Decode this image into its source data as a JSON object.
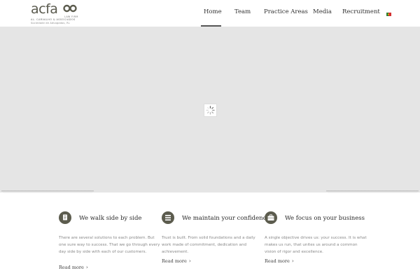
{
  "header": {
    "logo": {
      "brand": "acfa",
      "tagline": "LAW FIRM",
      "subtitle_1": "AL. CARVALHO & ASSOCIADOS",
      "subtitle_2": "Sociedade de Advogados, RL"
    },
    "nav": [
      {
        "label": "Home",
        "active": true
      },
      {
        "label": "Team",
        "active": false
      },
      {
        "label": "Practice Areas",
        "active": false
      },
      {
        "label": "Media",
        "active": false
      },
      {
        "label": "Recruitment",
        "active": false
      }
    ],
    "language_flag": "portugal-flag-icon"
  },
  "hero": {
    "background": "#e5e5e5",
    "loader_icon": "spinner-icon"
  },
  "features": [
    {
      "icon": "document-icon",
      "title": "We walk side by side",
      "body": "There are several solutions to each problem. But one sure way to success. That we go through every day side by side with each of our customers.",
      "link": "Read more"
    },
    {
      "icon": "list-icon",
      "title": "We maintain your confidence",
      "body": "Trust is built. From solid foundations and a daily work made of commitment, dedication and achievement.",
      "link": "Read more"
    },
    {
      "icon": "briefcase-icon",
      "title": "We focus on your business",
      "body": "A single objective drives us: your success. It is what makes us run, that unites us around a common vision of rigor and excellence.",
      "link": "Read more"
    }
  ],
  "colors": {
    "accent": "#5c5c4e",
    "hero_gray": "#e5e5e5",
    "text_muted": "#888888"
  }
}
